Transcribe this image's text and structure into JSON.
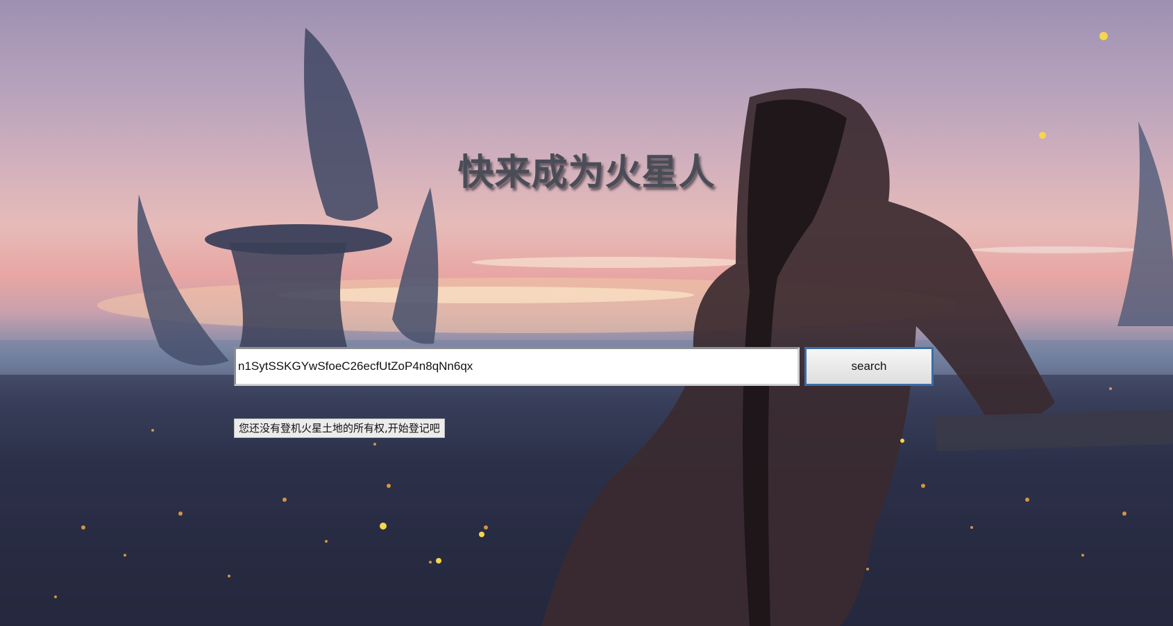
{
  "page": {
    "title": "快来成为火星人"
  },
  "search": {
    "value": "n1SytSSKGYwSfoeC26ecfUtZoP4n8qNn6qx",
    "button_label": "search"
  },
  "status": {
    "message": "您还没有登机火星土地的所有权,开始登记吧"
  },
  "background": {
    "description_icon": "fantasy-city-sunset-background"
  }
}
